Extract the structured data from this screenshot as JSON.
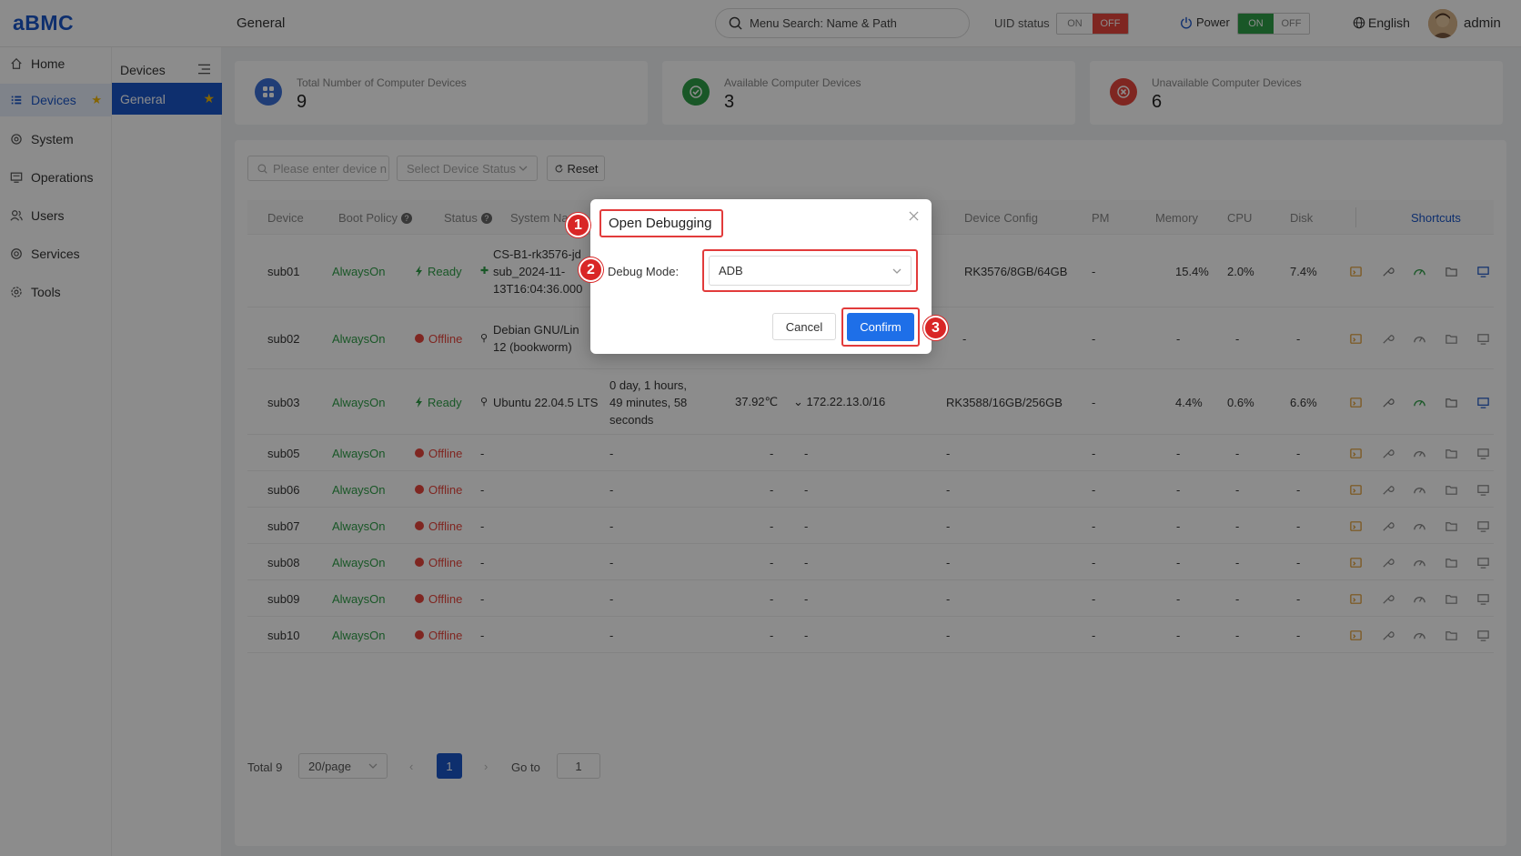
{
  "app": {
    "logo": "aBMC",
    "page_title": "General"
  },
  "header": {
    "search_placeholder": "Menu Search: Name & Path",
    "uid_label": "UID status",
    "uid_on": "ON",
    "uid_off": "OFF",
    "power_label": "Power",
    "power_on": "ON",
    "power_off": "OFF",
    "language": "English",
    "user": "admin"
  },
  "sidebar": {
    "items": [
      {
        "label": "Home",
        "icon": "home-icon"
      },
      {
        "label": "Devices",
        "icon": "list-icon",
        "active": true
      },
      {
        "label": "System",
        "icon": "gear-icon"
      },
      {
        "label": "Operations",
        "icon": "monitor-icon"
      },
      {
        "label": "Users",
        "icon": "users-icon"
      },
      {
        "label": "Services",
        "icon": "target-icon"
      },
      {
        "label": "Tools",
        "icon": "gear-icon"
      }
    ]
  },
  "subnav": {
    "header": "Devices",
    "active": "General"
  },
  "cards": [
    {
      "label": "Total Number of Computer Devices",
      "value": "9",
      "color": "#3b6fd8"
    },
    {
      "label": "Available Computer Devices",
      "value": "3",
      "color": "#2e9e47"
    },
    {
      "label": "Unavailable Computer Devices",
      "value": "6",
      "color": "#e8453c"
    }
  ],
  "filters": {
    "device_placeholder": "Please enter device name",
    "status_placeholder": "Select Device Status",
    "reset_label": "Reset"
  },
  "table": {
    "columns": [
      "Device",
      "Boot Policy",
      "Status",
      "System Name",
      "Device Config",
      "PM",
      "Memory",
      "CPU",
      "Disk",
      "Shortcuts"
    ],
    "rows": [
      {
        "device": "sub01",
        "policy": "AlwaysOn",
        "status": "Ready",
        "system": [
          "CS-B1-rk3576-jd",
          "sub_2024-11-",
          "13T16:04:36.000"
        ],
        "uptime": [],
        "temp": "",
        "ip": "",
        "config": "RK3576/8GB/64GB",
        "pm": "-",
        "memory": "15.4%",
        "cpu": "2.0%",
        "disk": "7.4%"
      },
      {
        "device": "sub02",
        "policy": "AlwaysOn",
        "status": "Offline",
        "system": [
          "Debian GNU/Lin",
          "12 (bookworm)"
        ],
        "uptime": [],
        "temp": "",
        "ip": "",
        "config": "-",
        "pm": "-",
        "memory": "-",
        "cpu": "-",
        "disk": "-"
      },
      {
        "device": "sub03",
        "policy": "AlwaysOn",
        "status": "Ready",
        "system": [
          "Ubuntu 22.04.5 LTS"
        ],
        "uptime": [
          "0 day, 1 hours,",
          "49 minutes, 58",
          "seconds"
        ],
        "temp": "37.92℃",
        "ip": "172.22.13.0/16",
        "config": "RK3588/16GB/256GB",
        "pm": "-",
        "memory": "4.4%",
        "cpu": "0.6%",
        "disk": "6.6%"
      },
      {
        "device": "sub05",
        "policy": "AlwaysOn",
        "status": "Offline",
        "system": [
          "-"
        ],
        "uptime": [
          "-"
        ],
        "temp": "-",
        "ip": "-",
        "config": "-",
        "pm": "-",
        "memory": "-",
        "cpu": "-",
        "disk": "-"
      },
      {
        "device": "sub06",
        "policy": "AlwaysOn",
        "status": "Offline",
        "system": [
          "-"
        ],
        "uptime": [
          "-"
        ],
        "temp": "-",
        "ip": "-",
        "config": "-",
        "pm": "-",
        "memory": "-",
        "cpu": "-",
        "disk": "-"
      },
      {
        "device": "sub07",
        "policy": "AlwaysOn",
        "status": "Offline",
        "system": [
          "-"
        ],
        "uptime": [
          "-"
        ],
        "temp": "-",
        "ip": "-",
        "config": "-",
        "pm": "-",
        "memory": "-",
        "cpu": "-",
        "disk": "-"
      },
      {
        "device": "sub08",
        "policy": "AlwaysOn",
        "status": "Offline",
        "system": [
          "-"
        ],
        "uptime": [
          "-"
        ],
        "temp": "-",
        "ip": "-",
        "config": "-",
        "pm": "-",
        "memory": "-",
        "cpu": "-",
        "disk": "-"
      },
      {
        "device": "sub09",
        "policy": "AlwaysOn",
        "status": "Offline",
        "system": [
          "-"
        ],
        "uptime": [
          "-"
        ],
        "temp": "-",
        "ip": "-",
        "config": "-",
        "pm": "-",
        "memory": "-",
        "cpu": "-",
        "disk": "-"
      },
      {
        "device": "sub10",
        "policy": "AlwaysOn",
        "status": "Offline",
        "system": [
          "-"
        ],
        "uptime": [
          "-"
        ],
        "temp": "-",
        "ip": "-",
        "config": "-",
        "pm": "-",
        "memory": "-",
        "cpu": "-",
        "disk": "-"
      }
    ]
  },
  "pagination": {
    "total": "Total 9",
    "page_size": "20/page",
    "current": "1",
    "goto_label": "Go to",
    "goto_value": "1"
  },
  "dialog": {
    "title": "Open Debugging",
    "field_label": "Debug Mode:",
    "field_value": "ADB",
    "cancel": "Cancel",
    "confirm": "Confirm"
  },
  "annotations": [
    "1",
    "2",
    "3"
  ],
  "colors": {
    "primary": "#1b56c8",
    "ready": "#2e9e47",
    "offline": "#e8453c",
    "annotation": "#d92626"
  }
}
